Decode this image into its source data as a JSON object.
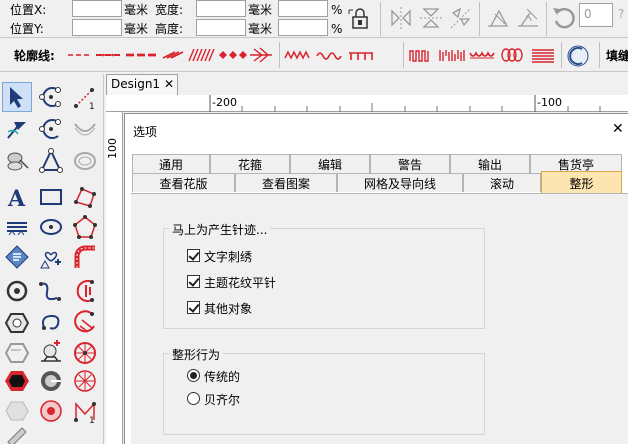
{
  "coords": {
    "pos_x_label": "位置X:",
    "pos_y_label": "位置Y:",
    "unit": "毫米",
    "width_label": "宽度:",
    "height_label": "高度:",
    "percent": "%",
    "rotate_value": "0",
    "help_glyph": "?"
  },
  "contour": {
    "label": "轮廓线:",
    "fill_label": "填缝"
  },
  "document": {
    "tab_label": "Design1",
    "close": "✕"
  },
  "ruler": {
    "h_marks": [
      "-200",
      "-100"
    ],
    "v_marks": [
      "100"
    ]
  },
  "dialog": {
    "title": "选项",
    "close": "✕",
    "tabs_row1": [
      "通用",
      "花箍",
      "编辑",
      "警告",
      "输出",
      "售货亭"
    ],
    "tabs_row2": [
      "查看花版",
      "查看图案",
      "网格及导向线",
      "滚动",
      "整形"
    ],
    "active_tab": "整形",
    "group1": {
      "title": "马上为产生针迹...",
      "options": [
        "文字刺绣",
        "主题花纹平针",
        "其他对象"
      ]
    },
    "group2": {
      "title": "整形行为",
      "options": [
        "传统的",
        "贝齐尔"
      ],
      "selected": "传统的"
    }
  },
  "colors": {
    "accent_red": "#d9232d",
    "active_tab": "#fce5b0",
    "tool_blue": "#1f3c78"
  }
}
